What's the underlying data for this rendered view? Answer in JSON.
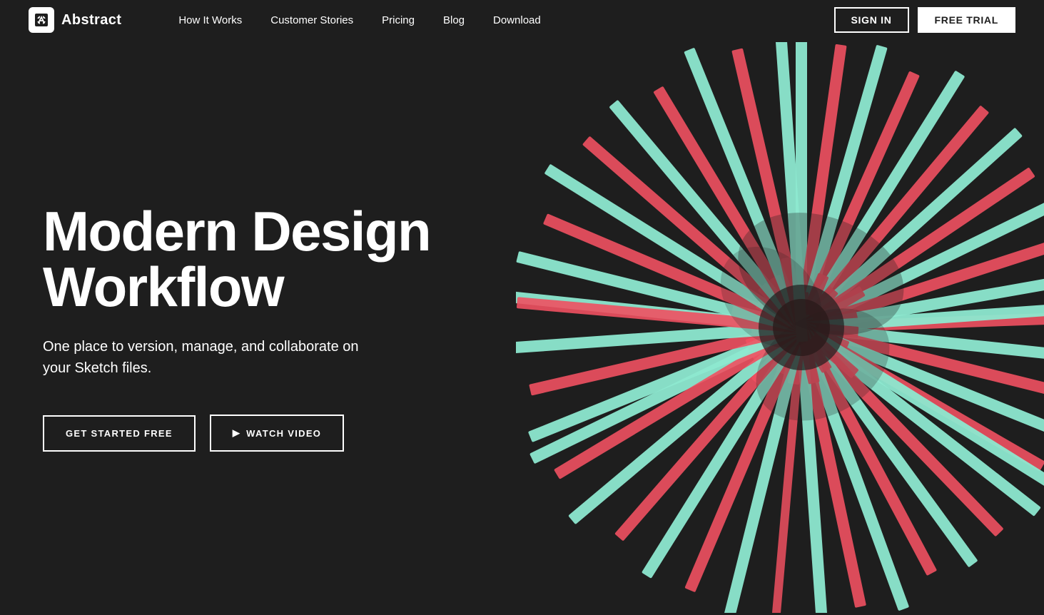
{
  "nav": {
    "logo_text": "Abstract",
    "links": [
      {
        "label": "How It Works",
        "id": "how-it-works"
      },
      {
        "label": "Customer Stories",
        "id": "customer-stories"
      },
      {
        "label": "Pricing",
        "id": "pricing"
      },
      {
        "label": "Blog",
        "id": "blog"
      },
      {
        "label": "Download",
        "id": "download"
      }
    ],
    "signin_label": "SIGN IN",
    "free_trial_label": "FREE TRIAL"
  },
  "hero": {
    "title": "Modern Design Workflow",
    "subtitle": "One place to version, manage, and collaborate on your Sketch files.",
    "get_started_label": "GET STARTED FREE",
    "watch_video_label": "WATCH VIDEO"
  },
  "colors": {
    "background": "#1e1e1e",
    "accent_mint": "#8de8d0",
    "accent_red": "#f05060"
  }
}
